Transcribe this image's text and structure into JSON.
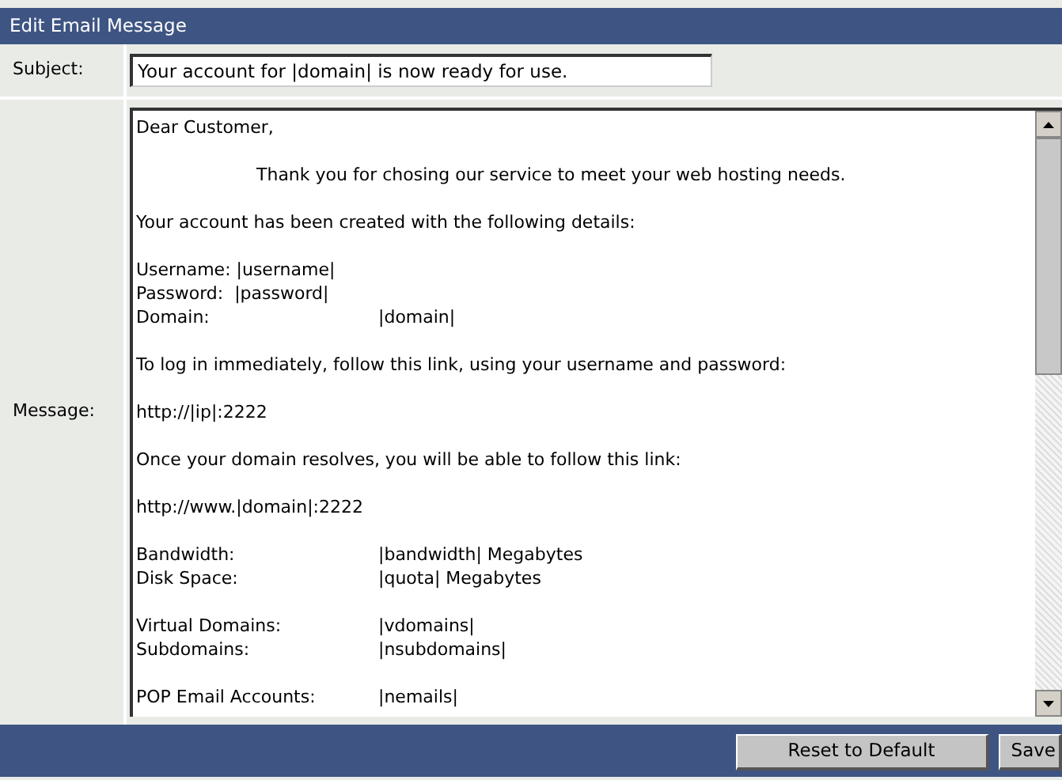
{
  "header": {
    "title": "Edit Email Message"
  },
  "subject": {
    "label": "Subject:",
    "value": "Your account for |domain| is now ready for use."
  },
  "message": {
    "label": "Message:",
    "blocks": [
      [
        {
          "kind": "text",
          "text": "Dear Customer,"
        }
      ],
      [
        {
          "kind": "indented",
          "text": "Thank you for chosing our service to meet your web hosting needs."
        }
      ],
      [
        {
          "kind": "text",
          "text": "Your account has been created with the following details:"
        }
      ],
      [
        {
          "kind": "text",
          "text": "Username: |username|"
        },
        {
          "kind": "text",
          "text": "Password:  |password|"
        },
        {
          "kind": "field",
          "label": "Domain:",
          "value": "|domain|"
        }
      ],
      [
        {
          "kind": "text",
          "text": "To log in immediately, follow this link, using your username and password:"
        }
      ],
      [
        {
          "kind": "text",
          "text": "http://|ip|:2222"
        }
      ],
      [
        {
          "kind": "text",
          "text": "Once your domain resolves, you will be able to follow this link:"
        }
      ],
      [
        {
          "kind": "text",
          "text": "http://www.|domain|:2222"
        }
      ],
      [
        {
          "kind": "field",
          "label": "Bandwidth:",
          "value": "|bandwidth| Megabytes"
        },
        {
          "kind": "field",
          "label": "Disk Space:",
          "value": "|quota| Megabytes"
        }
      ],
      [
        {
          "kind": "field",
          "label": "Virtual Domains:",
          "value": "|vdomains|"
        },
        {
          "kind": "field",
          "label": "Subdomains:",
          "value": "|nsubdomains|"
        }
      ],
      [
        {
          "kind": "field",
          "label": "POP Email Accounts:",
          "value": "|nemails|"
        }
      ]
    ]
  },
  "buttons": [
    "Reset to Default",
    "Save"
  ]
}
